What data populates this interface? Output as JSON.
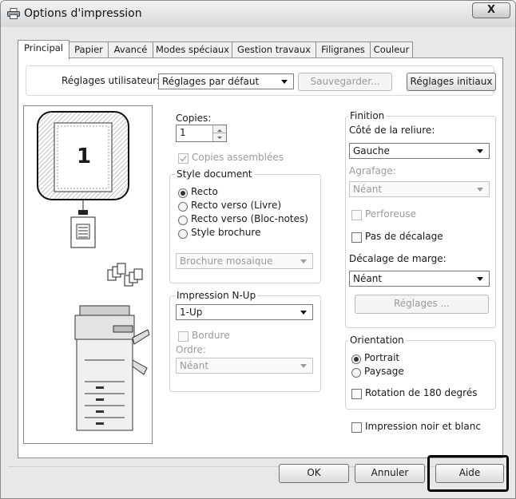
{
  "window": {
    "title": "Options d'impression",
    "close_label": "X"
  },
  "tabs": [
    "Principal",
    "Papier",
    "Avancé",
    "Modes spéciaux",
    "Gestion travaux",
    "Filigranes",
    "Couleur"
  ],
  "user_settings": {
    "label": "Réglages utilisateur:",
    "value": "Réglages par défaut",
    "save_label": "Sauvegarder...",
    "reset_label": "Réglages initiaux"
  },
  "preview": {
    "page_number": "1"
  },
  "copies": {
    "label": "Copies:",
    "value": "1",
    "collate_label": "Copies assemblées"
  },
  "document_style": {
    "legend": "Style document",
    "options": [
      "Recto",
      "Recto verso (Livre)",
      "Recto verso (Bloc-notes)",
      "Style brochure"
    ],
    "selected": "Recto",
    "brochure_select": "Brochure mosaique"
  },
  "nup": {
    "legend": "Impression N-Up",
    "value": "1-Up",
    "border_label": "Bordure",
    "order_label": "Ordre:",
    "order_value": "Néant"
  },
  "finishing": {
    "legend": "Finition",
    "binding_label": "Côté de la reliure:",
    "binding_value": "Gauche",
    "staple_label": "Agrafage:",
    "staple_value": "Néant",
    "punch_label": "Perforeuse",
    "no_offset_label": "Pas de décalage",
    "margin_label": "Décalage de marge:",
    "margin_value": "Néant",
    "settings_label": "Réglages ..."
  },
  "orientation": {
    "legend": "Orientation",
    "options": [
      "Portrait",
      "Paysage"
    ],
    "selected": "Portrait",
    "rotate_label": "Rotation de 180 degrés"
  },
  "bw_label": "Impression noir et blanc",
  "buttons": {
    "ok": "OK",
    "cancel": "Annuler",
    "help": "Aide"
  }
}
